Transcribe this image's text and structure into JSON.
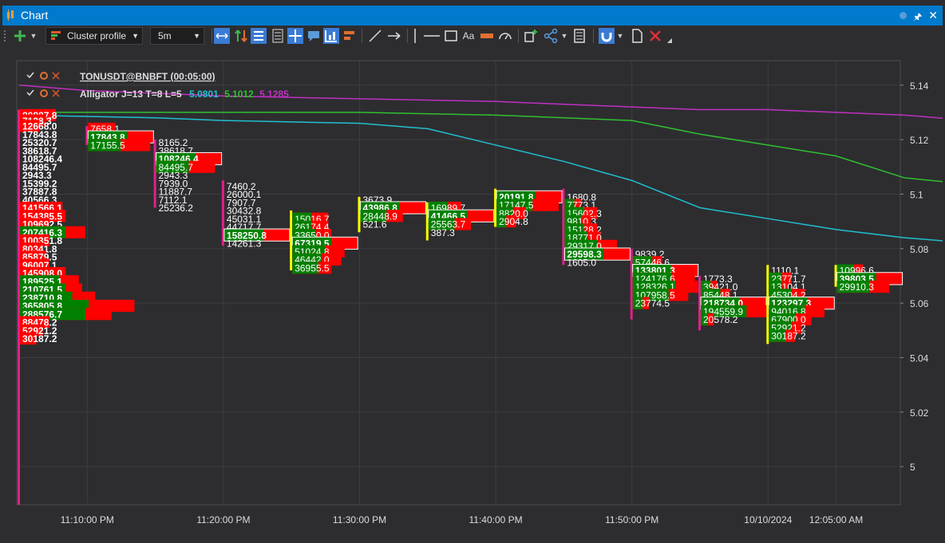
{
  "window": {
    "title": "Chart"
  },
  "toolbar": {
    "profile_label": "Cluster profile",
    "timeframe_label": "5m",
    "aa_label": "Aa"
  },
  "legend": {
    "instrument": "TONUSDT@BNBFT (00:05:00)",
    "indicator": "Alligator J=13 T=8 L=5",
    "val1": "5.0801",
    "val2": "5.1012",
    "val3": "5.1285"
  },
  "colors": {
    "background": "#2d2d30",
    "grid": "#3c3c42",
    "ask": "#ff0000",
    "bid": "#008000",
    "jaw": "#20c0d0",
    "teeth": "#30c030",
    "lips": "#c030c0",
    "wick_up": "#ffff00",
    "wick_down": "#e0208a"
  },
  "chart_data": {
    "type": "cluster",
    "y_ticks": [
      "5.14",
      "5.12",
      "5.1",
      "5.08",
      "5.06",
      "5.04",
      "5.02",
      "5"
    ],
    "x_ticks": [
      "11:10:00 PM",
      "11:20:00 PM",
      "11:30:00 PM",
      "11:40:00 PM",
      "11:50:00 PM",
      "10/10/2024",
      "12:05:00 AM"
    ],
    "ylim": [
      4.986,
      5.149
    ],
    "alligator": {
      "jaw": [
        [
          0,
          5.129
        ],
        [
          2,
          5.128
        ],
        [
          3,
          5.127
        ],
        [
          5,
          5.126
        ],
        [
          6,
          5.124
        ],
        [
          7,
          5.118
        ],
        [
          8,
          5.112
        ],
        [
          9,
          5.105
        ],
        [
          10,
          5.095
        ],
        [
          11,
          5.091
        ],
        [
          12,
          5.087
        ],
        [
          13,
          5.084
        ],
        [
          14,
          5.082
        ],
        [
          15,
          5.079
        ],
        [
          16,
          5.075
        ],
        [
          17,
          5.067
        ],
        [
          18,
          5.057
        ],
        [
          19,
          5.053
        ]
      ],
      "teeth": [
        [
          0,
          5.13
        ],
        [
          3,
          5.13
        ],
        [
          5,
          5.13
        ],
        [
          7,
          5.129
        ],
        [
          9,
          5.127
        ],
        [
          10,
          5.122
        ],
        [
          12,
          5.114
        ],
        [
          13,
          5.106
        ],
        [
          15,
          5.101
        ],
        [
          17,
          5.096
        ],
        [
          18,
          5.093
        ],
        [
          19,
          5.088
        ]
      ],
      "lips": [
        [
          0,
          5.14
        ],
        [
          1,
          5.138
        ],
        [
          3,
          5.136
        ],
        [
          5,
          5.135
        ],
        [
          7,
          5.134
        ],
        [
          9,
          5.132
        ],
        [
          10,
          5.131
        ],
        [
          11,
          5.131
        ],
        [
          13,
          5.129
        ],
        [
          15,
          5.125
        ],
        [
          17,
          5.12
        ],
        [
          18,
          5.115
        ],
        [
          19,
          5.113
        ]
      ]
    },
    "candles": [
      {
        "t": 0,
        "high": 5.131,
        "low": 4.986,
        "rows": [
          {
            "price": 5.129,
            "text": "80887.8",
            "ask": 0.55,
            "bid": 0
          },
          {
            "price": 5.127,
            "text": "7128.3",
            "ask": 0.4,
            "bid": 0
          },
          {
            "price": 5.125,
            "text": "12668.0",
            "ask": 0.3,
            "bid": 0
          },
          {
            "price": 5.122,
            "text": "17843.8",
            "ask": 0,
            "bid": 0
          },
          {
            "price": 5.119,
            "text": "25320.7",
            "ask": 0,
            "bid": 0
          },
          {
            "price": 5.116,
            "text": "38618.7",
            "ask": 0,
            "bid": 0
          },
          {
            "price": 5.113,
            "text": "108246.4",
            "ask": 0,
            "bid": 0
          },
          {
            "price": 5.11,
            "text": "84495.7",
            "ask": 0,
            "bid": 0
          },
          {
            "price": 5.107,
            "text": "2943.3",
            "ask": 0,
            "bid": 0
          },
          {
            "price": 5.104,
            "text": "15399.2",
            "ask": 0,
            "bid": 0
          },
          {
            "price": 5.101,
            "text": "37887.8",
            "ask": 0,
            "bid": 0
          },
          {
            "price": 5.098,
            "text": "40566.3",
            "ask": 0,
            "bid": 0
          },
          {
            "price": 5.095,
            "text": "141566.1",
            "ask": 0.65,
            "bid": 0
          },
          {
            "price": 5.092,
            "text": "154385.5",
            "ask": 0.7,
            "bid": 0
          },
          {
            "price": 5.089,
            "text": "109692.5",
            "ask": 0.45,
            "bid": 0
          },
          {
            "price": 5.086,
            "text": "207416.3",
            "ask": 1.0,
            "bid": 0.7
          },
          {
            "price": 5.083,
            "text": "100351.8",
            "ask": 0.45,
            "bid": 0
          },
          {
            "price": 5.08,
            "text": "80341.8",
            "ask": 0.35,
            "bid": 0
          },
          {
            "price": 5.077,
            "text": "85879.5",
            "ask": 0.4,
            "bid": 0
          },
          {
            "price": 5.074,
            "text": "96007.1",
            "ask": 0.45,
            "bid": 0
          },
          {
            "price": 5.071,
            "text": "145908.0",
            "ask": 0.7,
            "bid": 0
          },
          {
            "price": 5.068,
            "text": "189525.1",
            "ask": 0.9,
            "bid": 0.6
          },
          {
            "price": 5.065,
            "text": "210761.5",
            "ask": 0.95,
            "bid": 0.7
          },
          {
            "price": 5.062,
            "text": "238710.8",
            "ask": 1.15,
            "bid": 0.8
          },
          {
            "price": 5.059,
            "text": "365805.8",
            "ask": 1.75,
            "bid": 1.05
          },
          {
            "price": 5.056,
            "text": "288576.7",
            "ask": 1.4,
            "bid": 1.0
          },
          {
            "price": 5.053,
            "text": "88478.2",
            "ask": 0.45,
            "bid": 0
          },
          {
            "price": 5.05,
            "text": "52921.2",
            "ask": 0.35,
            "bid": 0
          },
          {
            "price": 5.047,
            "text": "30187.2",
            "ask": 0.25,
            "bid": 0
          }
        ],
        "poc": "",
        "poc_price": 0
      },
      {
        "t": 1,
        "high": 5.125,
        "low": 5.118,
        "rows": [
          {
            "price": 5.124,
            "text": "7658.1",
            "ask": 0.42,
            "bid": 0
          },
          {
            "price": 5.121,
            "text": "17843.8",
            "ask": 0,
            "bid": 0
          },
          {
            "price": 5.118,
            "text": "17155.5",
            "ask": 0.95,
            "bid": 0.5
          }
        ],
        "poc": "17843.8",
        "poc_price": 5.121
      },
      {
        "t": 2,
        "high": 5.12,
        "low": 5.095,
        "rows": [
          {
            "price": 5.119,
            "text": "8165.2",
            "ask": 0,
            "bid": 0
          },
          {
            "price": 5.116,
            "text": "38618.7",
            "ask": 0,
            "bid": 0
          },
          {
            "price": 5.113,
            "text": "108246.4",
            "ask": 0,
            "bid": 0
          },
          {
            "price": 5.11,
            "text": "84495.7",
            "ask": 0.9,
            "bid": 0.5
          },
          {
            "price": 5.107,
            "text": "2943.3",
            "ask": 0,
            "bid": 0
          },
          {
            "price": 5.104,
            "text": "7939.0",
            "ask": 0,
            "bid": 0
          },
          {
            "price": 5.101,
            "text": "11887.7",
            "ask": 0,
            "bid": 0
          },
          {
            "price": 5.098,
            "text": "7112.1",
            "ask": 0,
            "bid": 0
          },
          {
            "price": 5.095,
            "text": "25236.2",
            "ask": 0,
            "bid": 0
          }
        ],
        "poc": "108246.4",
        "poc_price": 5.113
      },
      {
        "t": 3,
        "high": 5.105,
        "low": 5.081,
        "rows": [
          {
            "price": 5.103,
            "text": "7460.2",
            "ask": 0,
            "bid": 0
          },
          {
            "price": 5.1,
            "text": "26000.1",
            "ask": 0,
            "bid": 0
          },
          {
            "price": 5.097,
            "text": "7907.7",
            "ask": 0,
            "bid": 0
          },
          {
            "price": 5.094,
            "text": "30432.8",
            "ask": 0,
            "bid": 0
          },
          {
            "price": 5.091,
            "text": "45031.1",
            "ask": 0,
            "bid": 0
          },
          {
            "price": 5.088,
            "text": "44717.7",
            "ask": 0,
            "bid": 0
          },
          {
            "price": 5.085,
            "text": "158250.8",
            "ask": 0,
            "bid": 0
          },
          {
            "price": 5.082,
            "text": "14261.3",
            "ask": 0,
            "bid": 0
          }
        ],
        "poc": "158250.8",
        "poc_price": 5.085
      },
      {
        "t": 4,
        "high": 5.094,
        "low": 5.072,
        "rows": [
          {
            "price": 5.091,
            "text": "15016.7",
            "ask": 0.55,
            "bid": 0.3
          },
          {
            "price": 5.088,
            "text": "26174.4",
            "ask": 0.55,
            "bid": 0.3
          },
          {
            "price": 5.085,
            "text": "33650.0",
            "ask": 0.6,
            "bid": 0.35
          },
          {
            "price": 5.082,
            "text": "67319.5",
            "ask": 0,
            "bid": 0
          },
          {
            "price": 5.079,
            "text": "51024.8",
            "ask": 0.8,
            "bid": 0.5
          },
          {
            "price": 5.076,
            "text": "46442.0",
            "ask": 0.75,
            "bid": 0.45
          },
          {
            "price": 5.073,
            "text": "36955.5",
            "ask": 0.6,
            "bid": 0.4
          }
        ],
        "poc": "67319.5",
        "poc_price": 5.082
      },
      {
        "t": 5,
        "high": 5.099,
        "low": 5.086,
        "rows": [
          {
            "price": 5.098,
            "text": "3673.9",
            "ask": 0,
            "bid": 0
          },
          {
            "price": 5.095,
            "text": "43986.8",
            "ask": 0,
            "bid": 0
          },
          {
            "price": 5.092,
            "text": "28448.9",
            "ask": 0.65,
            "bid": 0.4
          },
          {
            "price": 5.089,
            "text": "521.6",
            "ask": 0,
            "bid": 0
          }
        ],
        "poc": "43986.8",
        "poc_price": 5.095
      },
      {
        "t": 6,
        "high": 5.097,
        "low": 5.083,
        "rows": [
          {
            "price": 5.095,
            "text": "16989.7",
            "ask": 0.5,
            "bid": 0.3
          },
          {
            "price": 5.092,
            "text": "41466.5",
            "ask": 0,
            "bid": 0
          },
          {
            "price": 5.089,
            "text": "25563.7",
            "ask": 0.65,
            "bid": 0.4
          },
          {
            "price": 5.086,
            "text": "387.3",
            "ask": 0,
            "bid": 0
          }
        ],
        "poc": "41466.5",
        "poc_price": 5.092
      },
      {
        "t": 7,
        "high": 5.102,
        "low": 5.088,
        "rows": [
          {
            "price": 5.099,
            "text": "20191.8",
            "ask": 0,
            "bid": 0
          },
          {
            "price": 5.096,
            "text": "17147.5",
            "ask": 0.95,
            "bid": 0.55
          },
          {
            "price": 5.093,
            "text": "8820.0",
            "ask": 0.45,
            "bid": 0.25
          },
          {
            "price": 5.09,
            "text": "2904.8",
            "ask": 0.3,
            "bid": 0.15
          }
        ],
        "poc": "20191.8",
        "poc_price": 5.099
      },
      {
        "t": 8,
        "high": 5.102,
        "low": 5.074,
        "rows": [
          {
            "price": 5.099,
            "text": "1680.8",
            "ask": 0,
            "bid": 0
          },
          {
            "price": 5.096,
            "text": "7773.1",
            "ask": 0.25,
            "bid": 0.15
          },
          {
            "price": 5.093,
            "text": "15602.3",
            "ask": 0.5,
            "bid": 0.3
          },
          {
            "price": 5.09,
            "text": "9810.3",
            "ask": 0.4,
            "bid": 0.25
          },
          {
            "price": 5.087,
            "text": "15128.2",
            "ask": 0.5,
            "bid": 0.3
          },
          {
            "price": 5.084,
            "text": "18771.0",
            "ask": 0.55,
            "bid": 0.35
          },
          {
            "price": 5.081,
            "text": "29317.0",
            "ask": 0.8,
            "bid": 0.5
          },
          {
            "price": 5.078,
            "text": "29598.3",
            "ask": 0,
            "bid": 0
          },
          {
            "price": 5.075,
            "text": "1605.0",
            "ask": 0,
            "bid": 0
          }
        ],
        "poc": "29598.3",
        "poc_price": 5.078
      },
      {
        "t": 9,
        "high": 5.08,
        "low": 5.054,
        "rows": [
          {
            "price": 5.078,
            "text": "9839.2",
            "ask": 0,
            "bid": 0
          },
          {
            "price": 5.075,
            "text": "57446.6",
            "ask": 0.45,
            "bid": 0.3
          },
          {
            "price": 5.072,
            "text": "133801.3",
            "ask": 0,
            "bid": 0
          },
          {
            "price": 5.069,
            "text": "124176.6",
            "ask": 0.95,
            "bid": 0.6
          },
          {
            "price": 5.066,
            "text": "128326.1",
            "ask": 1.0,
            "bid": 0.65
          },
          {
            "price": 5.063,
            "text": "107958.5",
            "ask": 0.85,
            "bid": 0.55
          },
          {
            "price": 5.06,
            "text": "23774.5",
            "ask": 0.25,
            "bid": 0.15
          }
        ],
        "poc": "133801.3",
        "poc_price": 5.072
      },
      {
        "t": 10,
        "high": 5.07,
        "low": 5.05,
        "rows": [
          {
            "price": 5.069,
            "text": "1773.3",
            "ask": 0,
            "bid": 0
          },
          {
            "price": 5.066,
            "text": "39421.0",
            "ask": 0.25,
            "bid": 0.15
          },
          {
            "price": 5.063,
            "text": "85448.1",
            "ask": 0.45,
            "bid": 0.3
          },
          {
            "price": 5.06,
            "text": "218734.0",
            "ask": 0,
            "bid": 0
          },
          {
            "price": 5.057,
            "text": "194559.9",
            "ask": 1.05,
            "bid": 0.7
          },
          {
            "price": 5.054,
            "text": "20578.2",
            "ask": 0.2,
            "bid": 0.1
          }
        ],
        "poc": "218734.0",
        "poc_price": 5.06
      },
      {
        "t": 11,
        "high": 5.074,
        "low": 5.045,
        "rows": [
          {
            "price": 5.072,
            "text": "1110.1",
            "ask": 0,
            "bid": 0
          },
          {
            "price": 5.069,
            "text": "23771.7",
            "ask": 0.35,
            "bid": 0.2
          },
          {
            "price": 5.066,
            "text": "13104.1",
            "ask": 0.3,
            "bid": 0.2
          },
          {
            "price": 5.063,
            "text": "45304.2",
            "ask": 0.55,
            "bid": 0.35
          },
          {
            "price": 5.06,
            "text": "123297.3",
            "ask": 0,
            "bid": 0
          },
          {
            "price": 5.057,
            "text": "94016.8",
            "ask": 0.85,
            "bid": 0.55
          },
          {
            "price": 5.054,
            "text": "67900.0",
            "ask": 0.65,
            "bid": 0.4
          },
          {
            "price": 5.051,
            "text": "52921.2",
            "ask": 0.5,
            "bid": 0.35
          },
          {
            "price": 5.048,
            "text": "30187.2",
            "ask": 0.4,
            "bid": 0.25
          }
        ],
        "poc": "123297.3",
        "poc_price": 5.06
      },
      {
        "t": 12,
        "high": 5.074,
        "low": 5.066,
        "rows": [
          {
            "price": 5.072,
            "text": "10996.6",
            "ask": 0.4,
            "bid": 0.25
          },
          {
            "price": 5.069,
            "text": "39803.5",
            "ask": 0,
            "bid": 0
          },
          {
            "price": 5.066,
            "text": "29910.3",
            "ask": 0.8,
            "bid": 0.5
          }
        ],
        "poc": "39803.5",
        "poc_price": 5.069
      }
    ]
  }
}
